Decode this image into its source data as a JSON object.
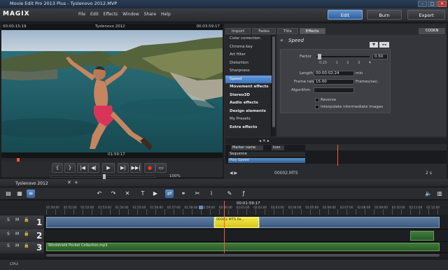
{
  "window": {
    "title": "Movie Edit Pro 2013 Plus - Tyslenovo 2012.MVP",
    "buttons": [
      "–",
      "□",
      "✕"
    ]
  },
  "menubar": {
    "logo": "MAGIX",
    "items": [
      "File",
      "Edit",
      "Effects",
      "Window",
      "Share",
      "Help"
    ]
  },
  "modes": {
    "edit": "Edit",
    "burn": "Burn",
    "export": "Export"
  },
  "monitor": {
    "timecode_left": "00:00:15:19",
    "project_title": "Tyslenovo 2012",
    "timecode_right": "00:03:59:17",
    "position_time": "01:59:17",
    "zoom": "100%"
  },
  "transport": {
    "buttons": [
      "{",
      "}",
      "|◀",
      "◀|",
      "▶",
      "▶|",
      "▶▶|",
      "●",
      "▭"
    ]
  },
  "right_panel": {
    "tabs": [
      "Import",
      "Fades",
      "Title",
      "Effects"
    ],
    "active_tab": "Effects",
    "brand": "COOKN",
    "effects_list": [
      {
        "label": "Color correction",
        "type": "item"
      },
      {
        "label": "Chroma key",
        "type": "item"
      },
      {
        "label": "Art filter",
        "type": "item"
      },
      {
        "label": "Distortion",
        "type": "item"
      },
      {
        "label": "Sharpness",
        "type": "item"
      },
      {
        "label": "Speed",
        "type": "selected"
      },
      {
        "label": "Movement effects",
        "type": "group"
      },
      {
        "label": "Stereo3D",
        "type": "group"
      },
      {
        "label": "Audio effects",
        "type": "group"
      },
      {
        "label": "Design elements",
        "type": "group"
      },
      {
        "label": "My Presets",
        "type": "item"
      },
      {
        "label": "Extra effects",
        "type": "group"
      }
    ],
    "speed": {
      "title": "Speed",
      "back_arrows": "«",
      "factor_label": "Factor",
      "factor_value": "0.50",
      "factor_fraction": 0.02,
      "factor_ticks": [
        "0.25",
        "1",
        "2",
        "3",
        "4"
      ],
      "length_label": "Length",
      "length_value": "00:00:02:24",
      "length_unit": "min",
      "framerate_label": "Frame rate",
      "framerate_value": "15.00",
      "framerate_unit": "Frames/sec.",
      "algorithm_label": "Algorithm",
      "algorithm_value": "",
      "reverse_label": "Reverse",
      "interpolate_label": "Interpolate intermediate images"
    },
    "marker_header": "Marker name",
    "marker_col": "Icon",
    "marker_rows": [
      {
        "label": "Sequence",
        "value": ""
      },
      {
        "label": "Play Speed",
        "value": ""
      }
    ],
    "bottom_file": "00002.MTS",
    "bottom_duration": "2 s"
  },
  "sequence": {
    "tab_name": "Tyslenovo 2012",
    "playhead_time": "00:01:59:17",
    "ruler_labels": [
      "01:50:00",
      "01:51:00",
      "01:52:00",
      "01:53:00",
      "01:54:00",
      "01:55:00",
      "01:56:00",
      "01:57:00",
      "01:58:00",
      "01:59:00",
      "02:00:00",
      "02:01:00",
      "02:02:00",
      "02:03:00",
      "02:04:00",
      "02:05:00",
      "02:06:00",
      "02:07:00",
      "02:08:00",
      "02:09:00",
      "02:10:00",
      "02:11:00",
      "02:12:00"
    ],
    "tracks": [
      {
        "num": "1",
        "controls": [
          "S",
          "M",
          "🔒"
        ]
      },
      {
        "num": "2",
        "controls": [
          "S",
          "M",
          "🔒"
        ]
      },
      {
        "num": "3",
        "controls": [
          "S",
          "M",
          "🔒"
        ]
      }
    ],
    "selected_clip": "00002.MTS 0x...",
    "audio_clip": "Windshield Pocket Collection.mp3"
  },
  "status": {
    "cpu": "CPU:"
  },
  "colors": {
    "accent": "#3a72b8",
    "clip_selected": "#e8dc2e",
    "playhead": "#ff5a2e",
    "audio": "#3f7a3a"
  }
}
